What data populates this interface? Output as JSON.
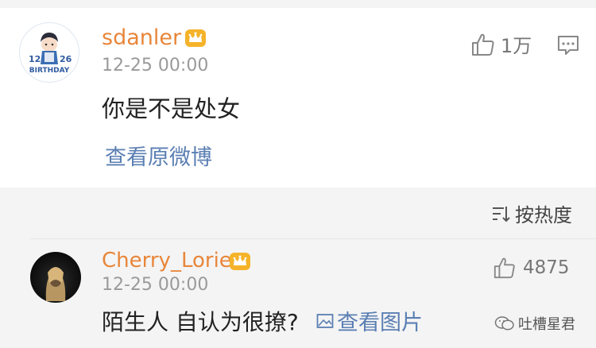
{
  "main_comment": {
    "avatar": {
      "icon": "birthday-avatar",
      "text_left": "12",
      "text_right": "26",
      "text_bottom": "BIRTHDAY"
    },
    "username": "sdanler",
    "badge_icon": "crown-icon",
    "timestamp": "12-25 00:00",
    "content": "你是不是处女",
    "view_original_label": "查看原微博",
    "like_count": "1万",
    "like_icon": "thumbs-up-icon",
    "comment_icon": "comment-icon"
  },
  "sort": {
    "label": "按热度",
    "icon": "sort-icon"
  },
  "reply": {
    "avatar_icon": "user-avatar",
    "username": "Cherry_Lorie",
    "badge_icon": "crown-icon",
    "timestamp": "12-25 00:00",
    "content": "陌生人 自认为很撩?",
    "view_image_label": "查看图片",
    "view_image_icon": "image-icon",
    "like_count": "4875",
    "like_icon": "thumbs-up-icon"
  },
  "watermark": {
    "text": "吐槽星君",
    "icon": "wechat-icon"
  },
  "colors": {
    "username": "#e8863a",
    "link": "#5b7fb3",
    "muted": "#9a9a9a",
    "background": "#f4f4f4",
    "card": "#ffffff"
  }
}
